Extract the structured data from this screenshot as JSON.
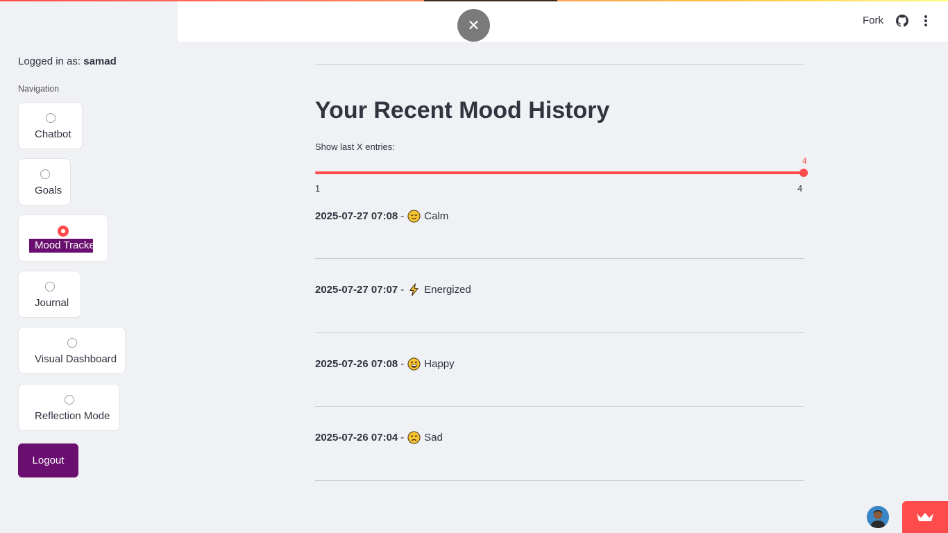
{
  "header": {
    "fork_label": "Fork"
  },
  "sidebar": {
    "logged_in_prefix": "Logged in as: ",
    "username": "samad",
    "nav_heading": "Navigation",
    "items": [
      {
        "label": "Chatbot",
        "selected": false
      },
      {
        "label": "Goals",
        "selected": false
      },
      {
        "label": "Mood Tracker",
        "selected": true
      },
      {
        "label": "Journal",
        "selected": false
      },
      {
        "label": "Visual Dashboard",
        "selected": false
      },
      {
        "label": "Reflection Mode",
        "selected": false
      }
    ],
    "logout_label": "Logout"
  },
  "main": {
    "title": "Your Recent Mood History",
    "slider": {
      "label": "Show last X entries:",
      "value": "4",
      "min": "1",
      "max": "4"
    },
    "entries": [
      {
        "timestamp": "2025-07-27 07:08",
        "separator": "-",
        "mood": "Calm",
        "icon": "relieved-face-icon"
      },
      {
        "timestamp": "2025-07-27 07:07",
        "separator": "-",
        "mood": "Energized",
        "icon": "lightning-icon"
      },
      {
        "timestamp": "2025-07-26 07:08",
        "separator": "-",
        "mood": "Happy",
        "icon": "grinning-face-icon"
      },
      {
        "timestamp": "2025-07-26 07:04",
        "separator": "-",
        "mood": "Sad",
        "icon": "sad-face-icon"
      }
    ]
  },
  "colors": {
    "accent": "#ff4b4b",
    "brand_purple": "#6a0f70",
    "background": "#f0f1f5"
  }
}
